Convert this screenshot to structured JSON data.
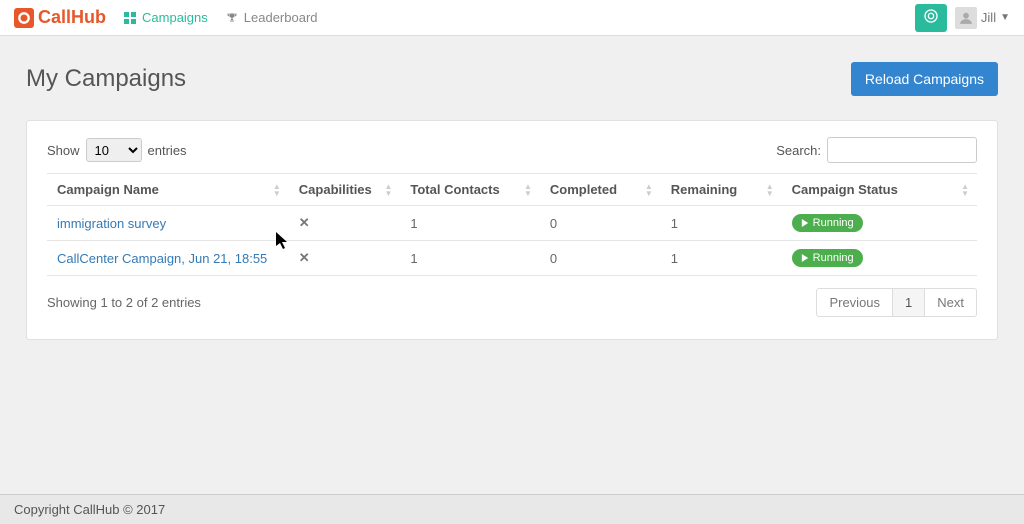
{
  "brand": {
    "name": "CallHub"
  },
  "nav": {
    "campaigns": "Campaigns",
    "leaderboard": "Leaderboard"
  },
  "user": {
    "name": "Jill"
  },
  "page": {
    "title": "My Campaigns",
    "reload_btn": "Reload Campaigns"
  },
  "table": {
    "show_label_pre": "Show",
    "show_label_post": "entries",
    "show_value": "10",
    "search_label": "Search:",
    "columns": [
      "Campaign Name",
      "Capabilities",
      "Total Contacts",
      "Completed",
      "Remaining",
      "Campaign Status"
    ],
    "rows": [
      {
        "name": "immigration survey",
        "capabilities": "x",
        "total_contacts": "1",
        "completed": "0",
        "remaining": "1",
        "status": "Running"
      },
      {
        "name": "CallCenter Campaign, Jun 21, 18:55",
        "capabilities": "x",
        "total_contacts": "1",
        "completed": "0",
        "remaining": "1",
        "status": "Running"
      }
    ],
    "info": "Showing 1 to 2 of 2 entries",
    "pagination": {
      "prev": "Previous",
      "next": "Next",
      "page": "1"
    }
  },
  "footer": {
    "copyright": "Copyright CallHub © 2017"
  }
}
